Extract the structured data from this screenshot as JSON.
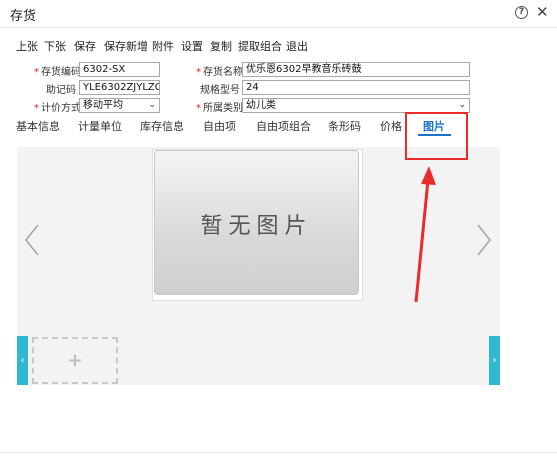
{
  "window": {
    "title": "存货",
    "help_icon": "help-icon",
    "close_icon": "close-icon",
    "help_glyph": "?",
    "close_glyph": "✕"
  },
  "toolbar": {
    "buttons": [
      "上张",
      "下张",
      "保存",
      "保存新增",
      "附件",
      "设置",
      "复制",
      "提取组合",
      "退出"
    ]
  },
  "form": {
    "inventory_code": {
      "label": "存货编码",
      "value": "6302-SX",
      "required": true
    },
    "inventory_name": {
      "label": "存货名称",
      "value": "优乐恩6302早教音乐砖鼓",
      "required": true
    },
    "mnemonic_code": {
      "label": "助记码",
      "value": "YLE6302ZJYLZG"
    },
    "spec_model": {
      "label": "规格型号",
      "value": "24"
    },
    "valuation_method": {
      "label": "计价方式",
      "value": "移动平均",
      "required": true
    },
    "category": {
      "label": "所属类别",
      "value": "幼儿类",
      "required": true
    }
  },
  "tabs": [
    "基本信息",
    "计量单位",
    "库存信息",
    "自由项",
    "自由项组合",
    "条形码",
    "价格",
    "图片"
  ],
  "active_tab": "图片",
  "image_panel": {
    "placeholder_text": "暂无图片",
    "add_glyph": "+",
    "prev_glyph": "‹",
    "next_glyph": "›"
  },
  "colors": {
    "accent": "#1a73c8",
    "annotation": "#ec2b2b",
    "strip": "#2fb8d0",
    "required": "#e02020"
  }
}
